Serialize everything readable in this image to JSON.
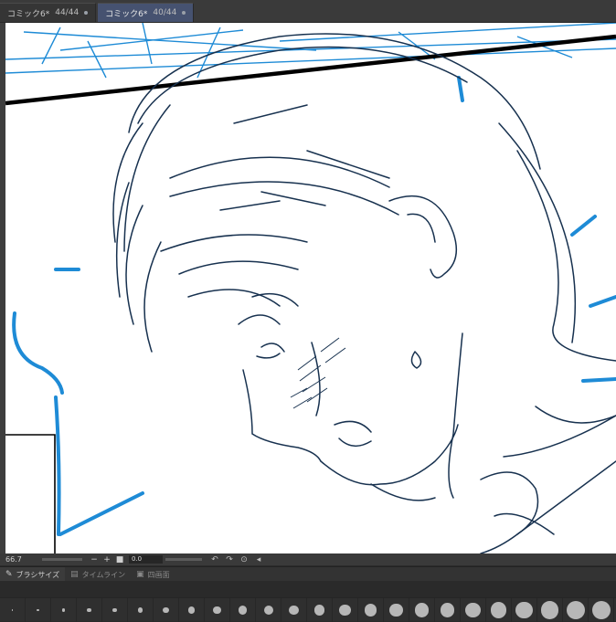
{
  "tabs": [
    {
      "title": "コミック6*",
      "count": "44/44",
      "active": false
    },
    {
      "title": "コミック6*",
      "count": "40/44",
      "active": true
    }
  ],
  "status": {
    "zoom": "66.7",
    "minus_icon": "zoom-out",
    "plus_icon": "zoom-in",
    "angle": "0.0",
    "rotate_left_icon": "rotate-left",
    "rotate_right_icon": "rotate-right",
    "reset_icon": "reset-rotation",
    "flip_icon": "flip-horizontal"
  },
  "palette": {
    "brush_size": "ブラシサイズ",
    "timeline": "タイムライン",
    "navigator": "四画面"
  },
  "brush_sizes": [
    1,
    1.5,
    2,
    2.5,
    3,
    3.5,
    4,
    5,
    6,
    7,
    8,
    10,
    12,
    15,
    17,
    20,
    25,
    30,
    40,
    50,
    60,
    70,
    80,
    100
  ],
  "colors": {
    "sketch_blue": "#1e8bd6",
    "line_navy": "#17314f",
    "panel_border": "#000000"
  }
}
